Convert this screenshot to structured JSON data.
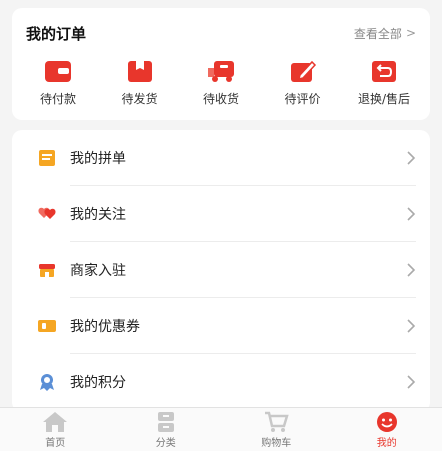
{
  "orders": {
    "title": "我的订单",
    "view_all": "查看全部",
    "items": [
      {
        "label": "待付款",
        "icon": "wallet-icon"
      },
      {
        "label": "待发货",
        "icon": "package-icon"
      },
      {
        "label": "待收货",
        "icon": "truck-icon"
      },
      {
        "label": "待评价",
        "icon": "edit-icon"
      },
      {
        "label": "退换/售后",
        "icon": "return-icon"
      }
    ]
  },
  "menu": {
    "items": [
      {
        "label": "我的拼单",
        "icon": "group-order-icon"
      },
      {
        "label": "我的关注",
        "icon": "heart-icon"
      },
      {
        "label": "商家入驻",
        "icon": "shop-icon"
      },
      {
        "label": "我的优惠券",
        "icon": "coupon-icon"
      },
      {
        "label": "我的积分",
        "icon": "points-icon"
      }
    ]
  },
  "tabbar": {
    "items": [
      {
        "label": "首页",
        "icon": "home-icon"
      },
      {
        "label": "分类",
        "icon": "category-icon"
      },
      {
        "label": "购物车",
        "icon": "cart-icon"
      },
      {
        "label": "我的",
        "icon": "profile-icon",
        "active": true
      }
    ]
  },
  "colors": {
    "accent": "#e8362c",
    "icon_yellow": "#f5a623"
  }
}
